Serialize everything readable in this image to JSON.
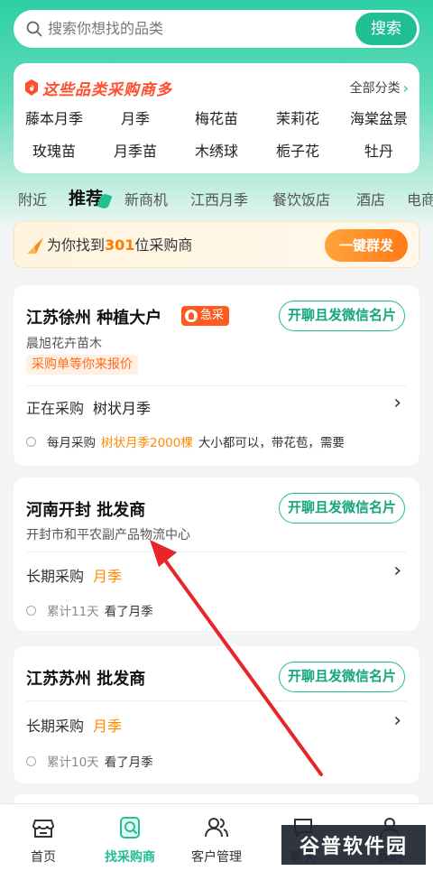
{
  "search": {
    "placeholder": "搜索你想找的品类",
    "button": "搜索"
  },
  "categories": {
    "title": "这些品类采购商多",
    "all_label": "全部分类",
    "items": [
      "藤本月季",
      "月季",
      "梅花苗",
      "茉莉花",
      "海棠盆景",
      "玫瑰苗",
      "月季苗",
      "木绣球",
      "栀子花",
      "牡丹"
    ]
  },
  "tabs": [
    "附近",
    "推荐",
    "新商机",
    "江西月季",
    "餐饮饭店",
    "酒店",
    "电商"
  ],
  "active_tab": "推荐",
  "found": {
    "prefix": "为你找到",
    "count": "301",
    "suffix": "位采购商",
    "button": "一键群发"
  },
  "cards": [
    {
      "name": "江苏徐州 种植大户",
      "badge": "急采",
      "chat": "开聊且发微信名片",
      "company": "晨旭花卉苗木",
      "tag": "采购单等你来报价",
      "row_label": "正在采购",
      "row_value": "树状月季",
      "info_a": "每月采购",
      "info_hl": "树状月季2000棵",
      "info_b": "大小都可以，带花苞，需要"
    },
    {
      "name": "河南开封 批发商",
      "chat": "开聊且发微信名片",
      "company": "开封市和平农副产品物流中心",
      "row_label": "长期采购",
      "row_value": "月季",
      "info_a": "累计11天",
      "info_b": "看了月季"
    },
    {
      "name": "江苏苏州 批发商",
      "chat": "开聊且发微信名片",
      "row_label": "长期采购",
      "row_value": "月季",
      "info_a": "累计10天",
      "info_b": "看了月季"
    }
  ],
  "nav": [
    "首页",
    "找采购商",
    "客户管理",
    "聊天",
    "我的"
  ],
  "nav_active": "找采购商",
  "watermark": "谷普软件园",
  "colors": {
    "brand": "#1fbe93",
    "accent": "#ff7a00",
    "annotation_arrow": "#e8262a"
  }
}
